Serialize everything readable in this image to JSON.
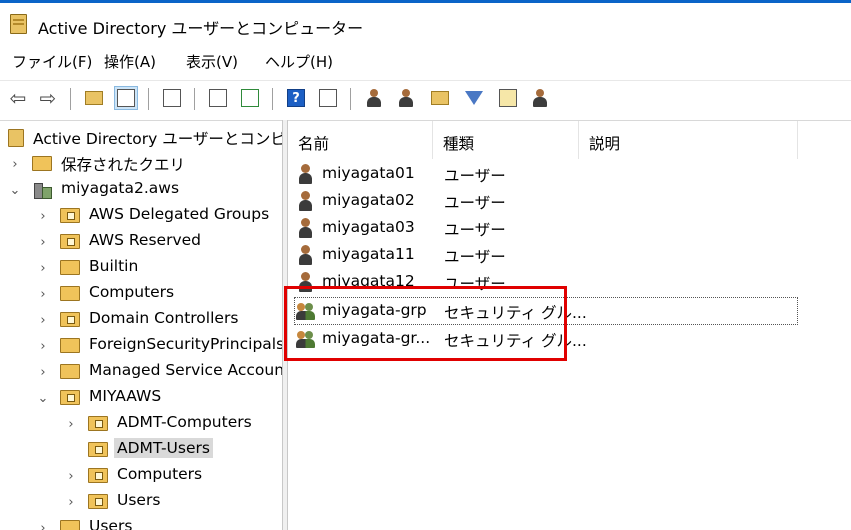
{
  "window": {
    "title": "Active Directory ユーザーとコンピューター"
  },
  "menu": [
    {
      "label": "ファイル(F)"
    },
    {
      "label": "操作(A)"
    },
    {
      "label": "表示(V)"
    },
    {
      "label": "ヘルプ(H)"
    }
  ],
  "toolbar": {
    "help_glyph": "?"
  },
  "tree": {
    "root": "Active Directory ユーザーとコンピュー",
    "items": [
      {
        "label": "保存されたクエリ",
        "chevron": "›"
      },
      {
        "label": "miyagata2.aws",
        "chevron": "⌄"
      },
      {
        "label": "AWS Delegated Groups",
        "chevron": "›"
      },
      {
        "label": "AWS Reserved",
        "chevron": "›"
      },
      {
        "label": "Builtin",
        "chevron": "›"
      },
      {
        "label": "Computers",
        "chevron": "›"
      },
      {
        "label": "Domain Controllers",
        "chevron": "›"
      },
      {
        "label": "ForeignSecurityPrincipals",
        "chevron": "›"
      },
      {
        "label": "Managed Service Accounts",
        "chevron": "›"
      },
      {
        "label": "MIYAAWS",
        "chevron": "⌄"
      },
      {
        "label": "ADMT-Computers",
        "chevron": "›"
      },
      {
        "label": "ADMT-Users",
        "chevron": ""
      },
      {
        "label": "Computers",
        "chevron": "›"
      },
      {
        "label": "Users",
        "chevron": "›"
      },
      {
        "label": "Users",
        "chevron": "›"
      }
    ]
  },
  "list": {
    "columns": [
      "名前",
      "種類",
      "説明"
    ],
    "rows": [
      {
        "name": "miyagata01",
        "type": "ユーザー",
        "icon": "user-icon"
      },
      {
        "name": "miyagata02",
        "type": "ユーザー",
        "icon": "user-icon"
      },
      {
        "name": "miyagata03",
        "type": "ユーザー",
        "icon": "user-icon"
      },
      {
        "name": "miyagata11",
        "type": "ユーザー",
        "icon": "user-icon"
      },
      {
        "name": "miyagata12",
        "type": "ユーザー",
        "icon": "user-icon"
      },
      {
        "name": "miyagata-grp",
        "type": "セキュリティ グル...",
        "icon": "group-icon"
      },
      {
        "name": "miyagata-gr...",
        "type": "セキュリティ グル...",
        "icon": "group-icon"
      }
    ]
  },
  "colors": {
    "highlight": "#e00000",
    "selection": "#d9d9d9",
    "accent": "#0a64c8"
  }
}
